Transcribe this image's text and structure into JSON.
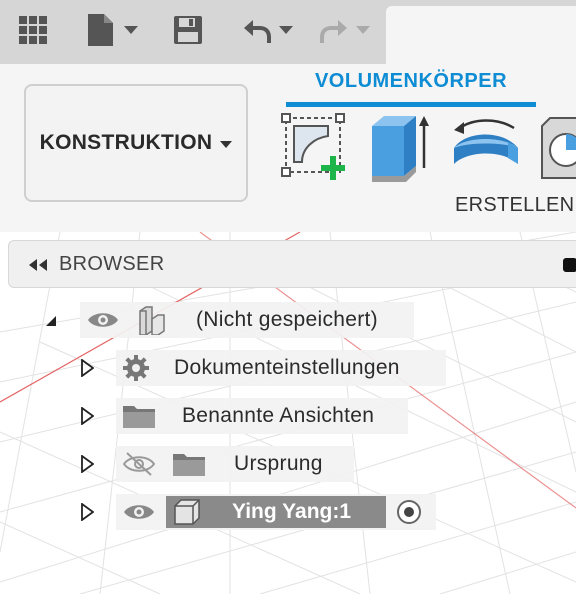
{
  "toolbar": {
    "grid_icon": "app-grid-icon",
    "file_icon": "file-icon",
    "save_icon": "save-icon",
    "undo_icon": "undo-icon",
    "redo_icon": "redo-icon"
  },
  "ribbon": {
    "workspace_label": "KONSTRUKTION",
    "active_tab": "VOLUMENKÖRPER",
    "accent_color": "#0e8dd4",
    "group_label": "ERSTELLEN",
    "tools": [
      "create-sketch-icon",
      "extrude-icon",
      "revolve-icon",
      "hole-icon"
    ]
  },
  "browser": {
    "title": "BROWSER",
    "items": [
      {
        "label": "(Nicht gespeichert)"
      },
      {
        "label": "Dokumenteinstellungen"
      },
      {
        "label": "Benannte Ansichten"
      },
      {
        "label": "Ursprung"
      },
      {
        "label": "Ying Yang:1"
      }
    ]
  }
}
